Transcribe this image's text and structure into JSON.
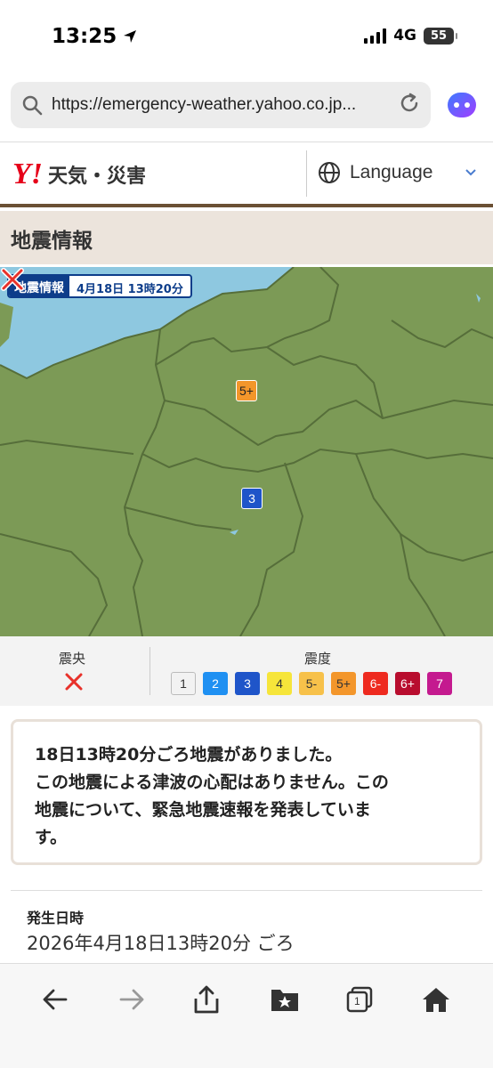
{
  "status": {
    "time": "13:25",
    "network": "4G",
    "battery": "55"
  },
  "browser": {
    "url": "https://emergency-weather.yahoo.co.jp...",
    "tab_count": "1"
  },
  "header": {
    "logo_mark": "Y!",
    "logo_text": "天気・災害",
    "language": "Language"
  },
  "page": {
    "title": "地震情報"
  },
  "map": {
    "badge_title": "地震情報",
    "badge_time": "4月18日  13時20分",
    "markers": [
      {
        "label": "5+",
        "bg": "#f3962b",
        "fg": "#222222"
      },
      {
        "label": "3",
        "bg": "#1f55c9",
        "fg": "#ffffff"
      }
    ]
  },
  "legend": {
    "epicenter_label": "震央",
    "intensity_label": "震度",
    "scale": [
      {
        "label": "1",
        "bg": "#f2f2f2",
        "fg": "#333333"
      },
      {
        "label": "2",
        "bg": "#1f90f2",
        "fg": "#ffffff"
      },
      {
        "label": "3",
        "bg": "#1f55c9",
        "fg": "#ffffff"
      },
      {
        "label": "4",
        "bg": "#f6e53a",
        "fg": "#333333"
      },
      {
        "label": "5-",
        "bg": "#f7c14a",
        "fg": "#333333"
      },
      {
        "label": "5+",
        "bg": "#f3962b",
        "fg": "#333333"
      },
      {
        "label": "6-",
        "bg": "#ee2a1f",
        "fg": "#ffffff"
      },
      {
        "label": "6+",
        "bg": "#b80d2e",
        "fg": "#ffffff"
      },
      {
        "label": "7",
        "bg": "#c41a8f",
        "fg": "#ffffff"
      }
    ]
  },
  "message": {
    "lines": [
      "18日13時20分ごろ地震がありました。",
      "この地震による津波の心配はありません。この",
      "地震について、緊急地震速報を発表していま",
      "す。"
    ]
  },
  "details": {
    "date_label": "発生日時",
    "date_value": "2026年4月18日13時20分 ごろ"
  },
  "colors": {
    "accent_brown": "#6b5034",
    "map_land": "#7c9a56",
    "map_water": "#8ec8e0",
    "brand_red": "#e60019"
  }
}
